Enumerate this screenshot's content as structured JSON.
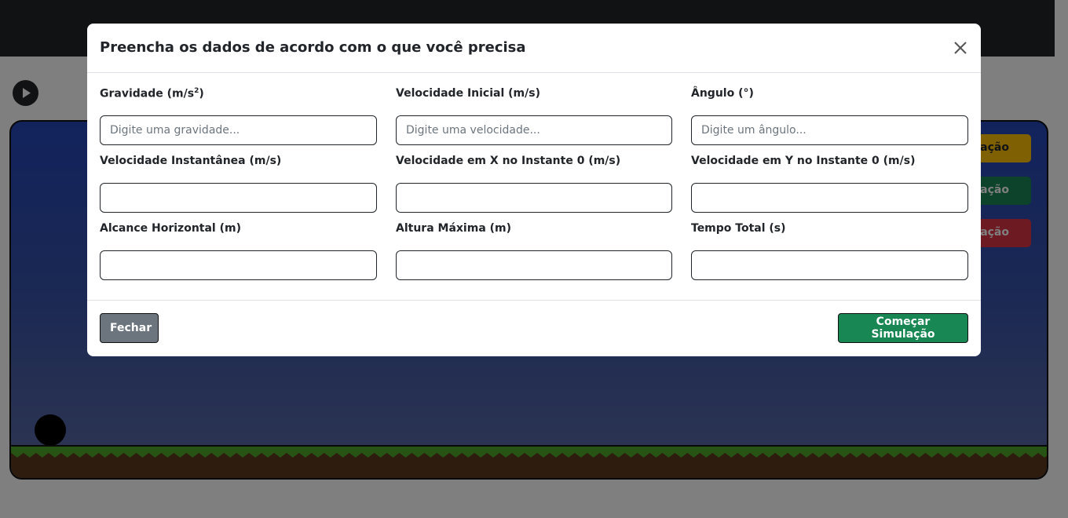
{
  "background": {
    "nav_text": "",
    "side_buttons": [
      {
        "label": "lação",
        "color": "#ffc107"
      },
      {
        "label": "mulação",
        "color": "#198754"
      },
      {
        "label": "ulação",
        "color": "#dc3545"
      }
    ]
  },
  "modal": {
    "title": "Preencha os dados de acordo com o que você precisa",
    "fields": [
      {
        "label": "Gravidade (m/s",
        "label_sup": "2",
        "label_suffix": ")",
        "placeholder": "Digite uma gravidade...",
        "value": ""
      },
      {
        "label": "Velocidade Inicial (m/s)",
        "placeholder": "Digite uma velocidade...",
        "value": ""
      },
      {
        "label": "Ângulo (°)",
        "placeholder": "Digite um ângulo...",
        "value": ""
      },
      {
        "label": "Velocidade Instantânea (m/s)",
        "placeholder": "",
        "value": ""
      },
      {
        "label": "Velocidade em X no Instante 0 (m/s)",
        "placeholder": "",
        "value": ""
      },
      {
        "label": "Velocidade em Y no Instante 0 (m/s)",
        "placeholder": "",
        "value": ""
      },
      {
        "label": "Alcance Horizontal (m)",
        "placeholder": "",
        "value": ""
      },
      {
        "label": "Altura Máxima (m)",
        "placeholder": "",
        "value": ""
      },
      {
        "label": "Tempo Total (s)",
        "placeholder": "",
        "value": ""
      }
    ],
    "close_label": "Fechar",
    "start_label": "Começar Simulação"
  },
  "colors": {
    "primary_green": "#198754",
    "secondary_gray": "#6c757d",
    "warning_yellow": "#ffc107",
    "danger_red": "#dc3545"
  }
}
